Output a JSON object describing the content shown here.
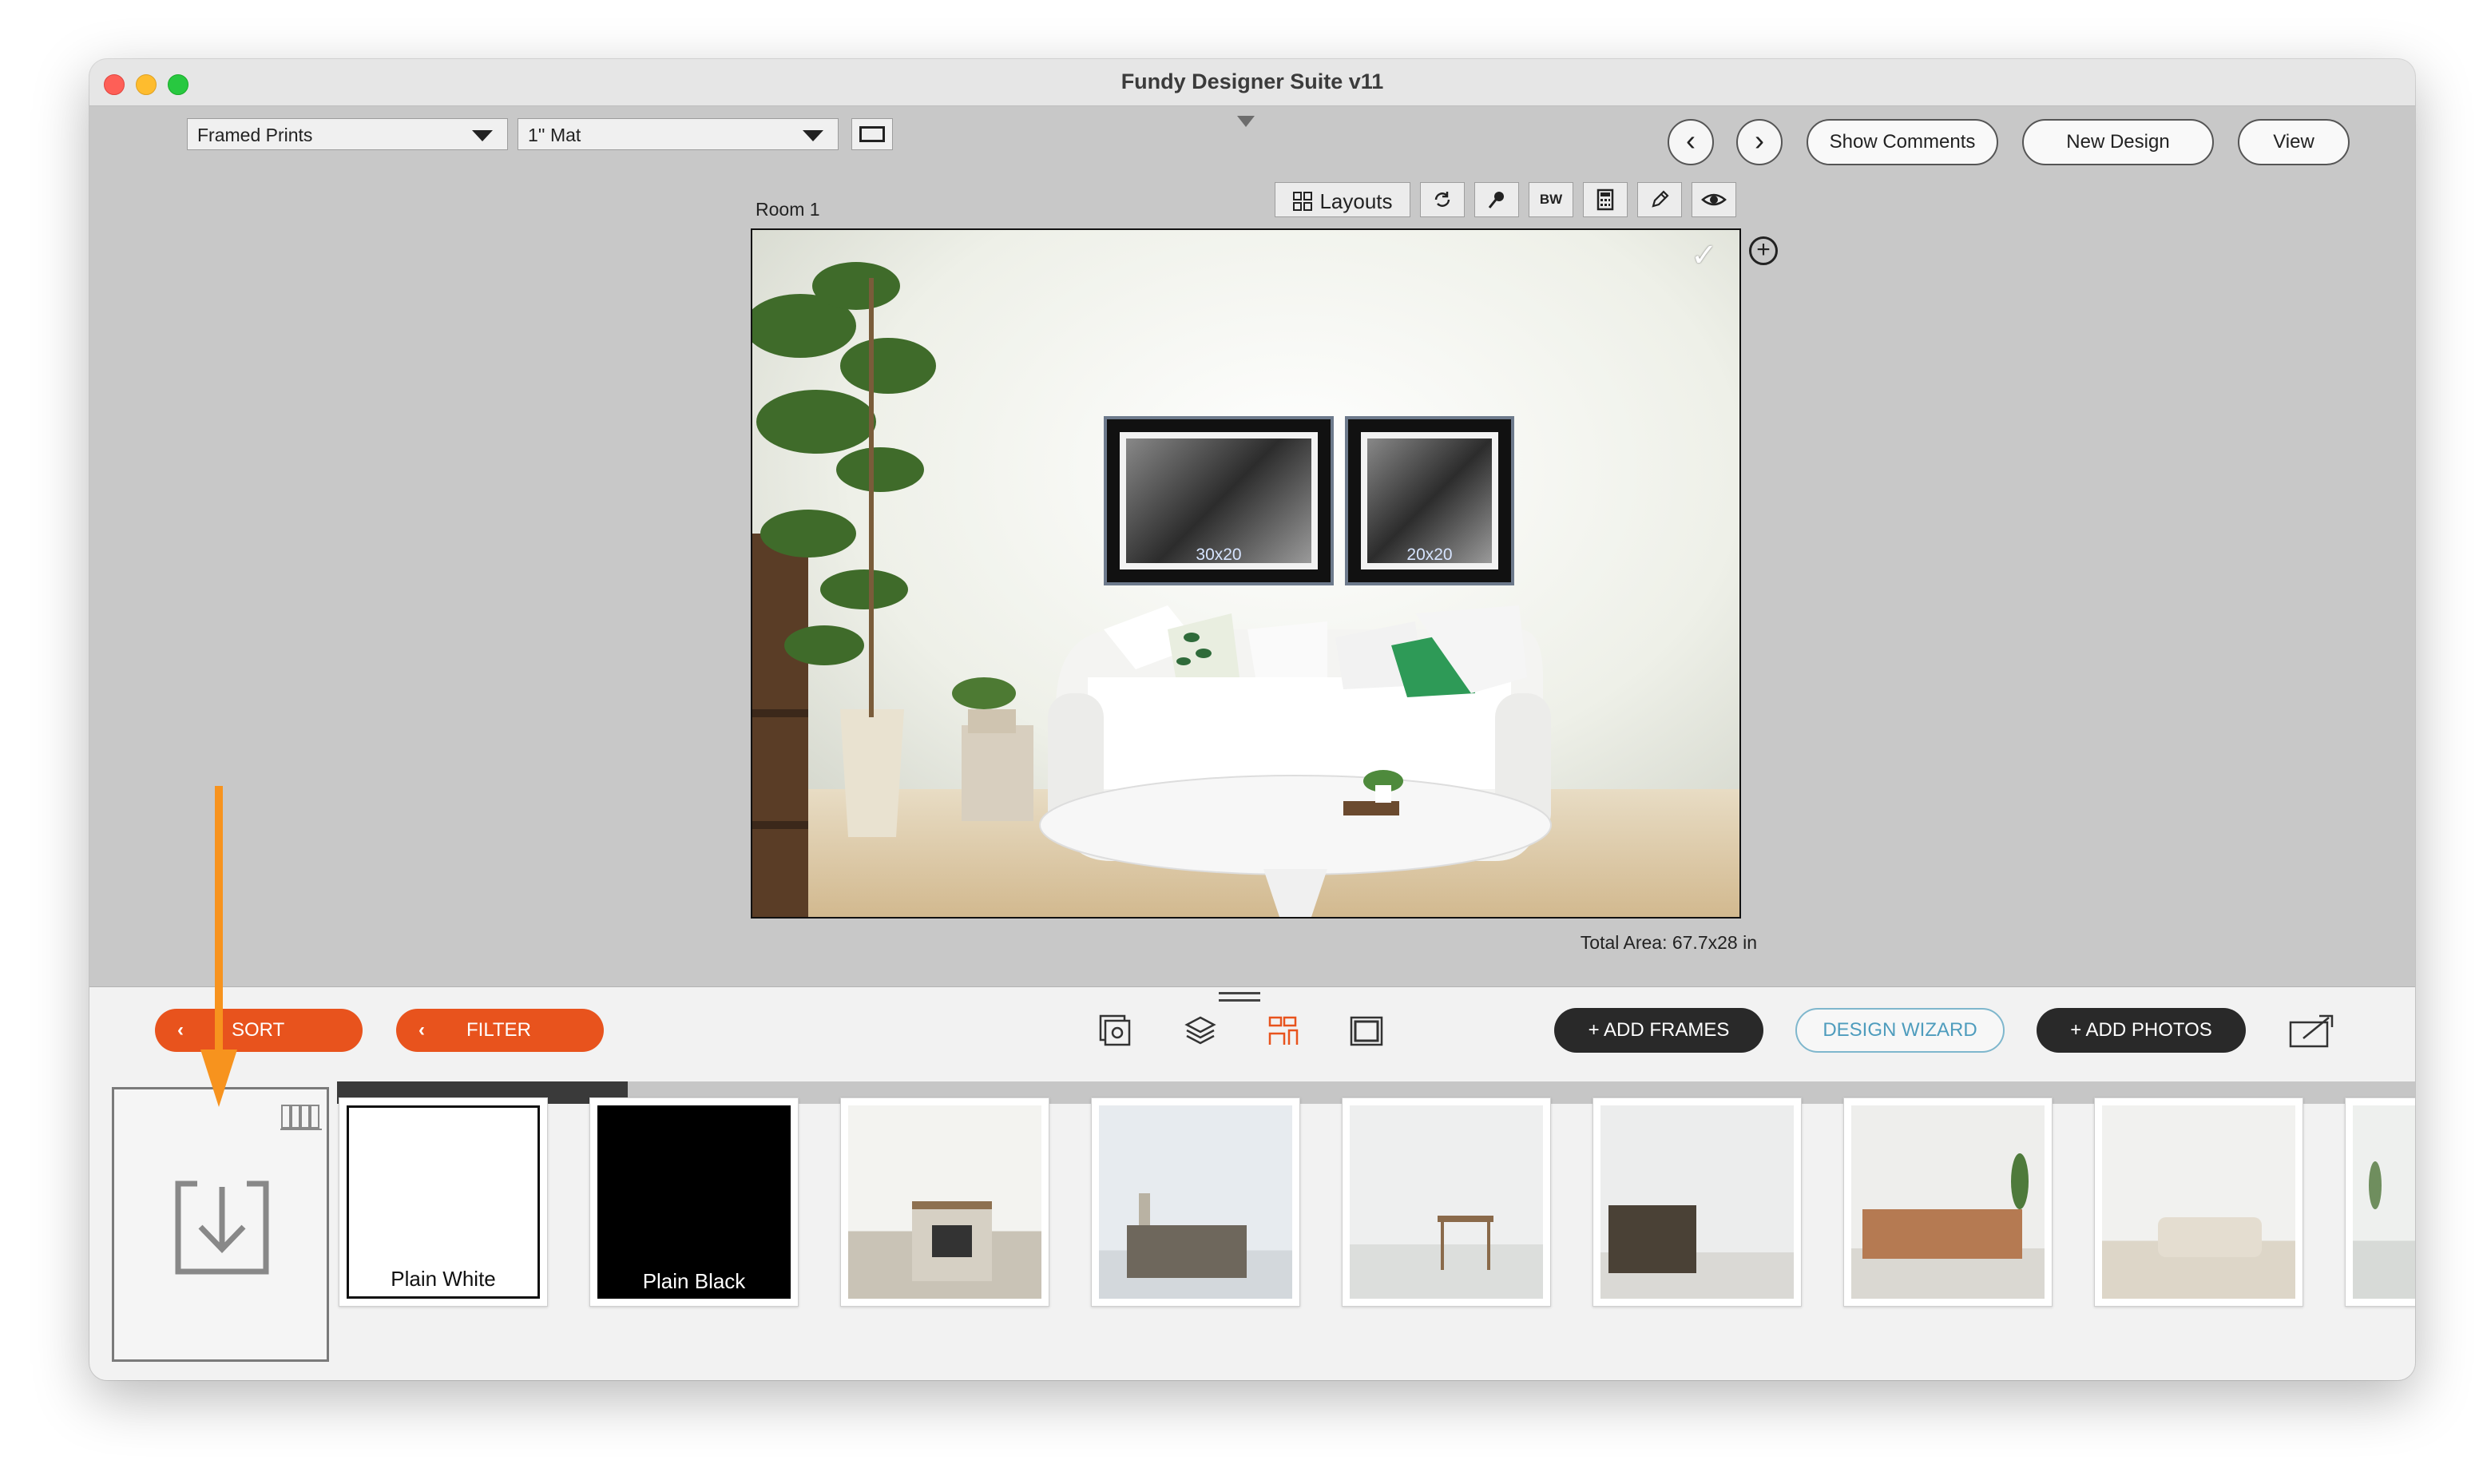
{
  "window": {
    "title": "Fundy Designer Suite v11"
  },
  "top_toolbar": {
    "product_select": "Framed Prints",
    "mat_select": "1'' Mat",
    "back_glyph": "‹",
    "forward_glyph": "›",
    "show_comments": "Show Comments",
    "new_design": "New Design",
    "view": "View"
  },
  "room": {
    "label": "Room 1",
    "layouts_label": "Layouts",
    "bw_label": "BW",
    "total_area": "Total Area: 67.7x28 in",
    "frames": [
      {
        "size": "30x20"
      },
      {
        "size": "20x20"
      }
    ]
  },
  "bottom_panel": {
    "sort_label": "SORT",
    "filter_label": "FILTER",
    "add_frames": "+ ADD FRAMES",
    "design_wizard": "DESIGN WIZARD",
    "add_photos": "+ ADD PHOTOS",
    "scroll_progress": 0.14,
    "tiles": [
      {
        "caption": "Plain White"
      },
      {
        "caption": "Plain Black"
      },
      {
        "caption": ""
      },
      {
        "caption": ""
      },
      {
        "caption": ""
      },
      {
        "caption": ""
      },
      {
        "caption": ""
      },
      {
        "caption": ""
      },
      {
        "caption": ""
      }
    ]
  },
  "colors": {
    "accent_orange": "#e8531d",
    "dark_button": "#292929",
    "wizard_blue": "#4e9cbd"
  },
  "icons": [
    "chevron-left-icon",
    "chevron-right-icon",
    "layouts-icon",
    "rotate-icon",
    "pin-icon",
    "calculator-icon",
    "pencil-icon",
    "eye-icon",
    "checkmark-icon",
    "add-circle-icon",
    "gallery-icon",
    "layers-icon",
    "room-icon",
    "frame-icon",
    "share-icon",
    "import-icon",
    "library-icon",
    "arrow-down-icon"
  ]
}
